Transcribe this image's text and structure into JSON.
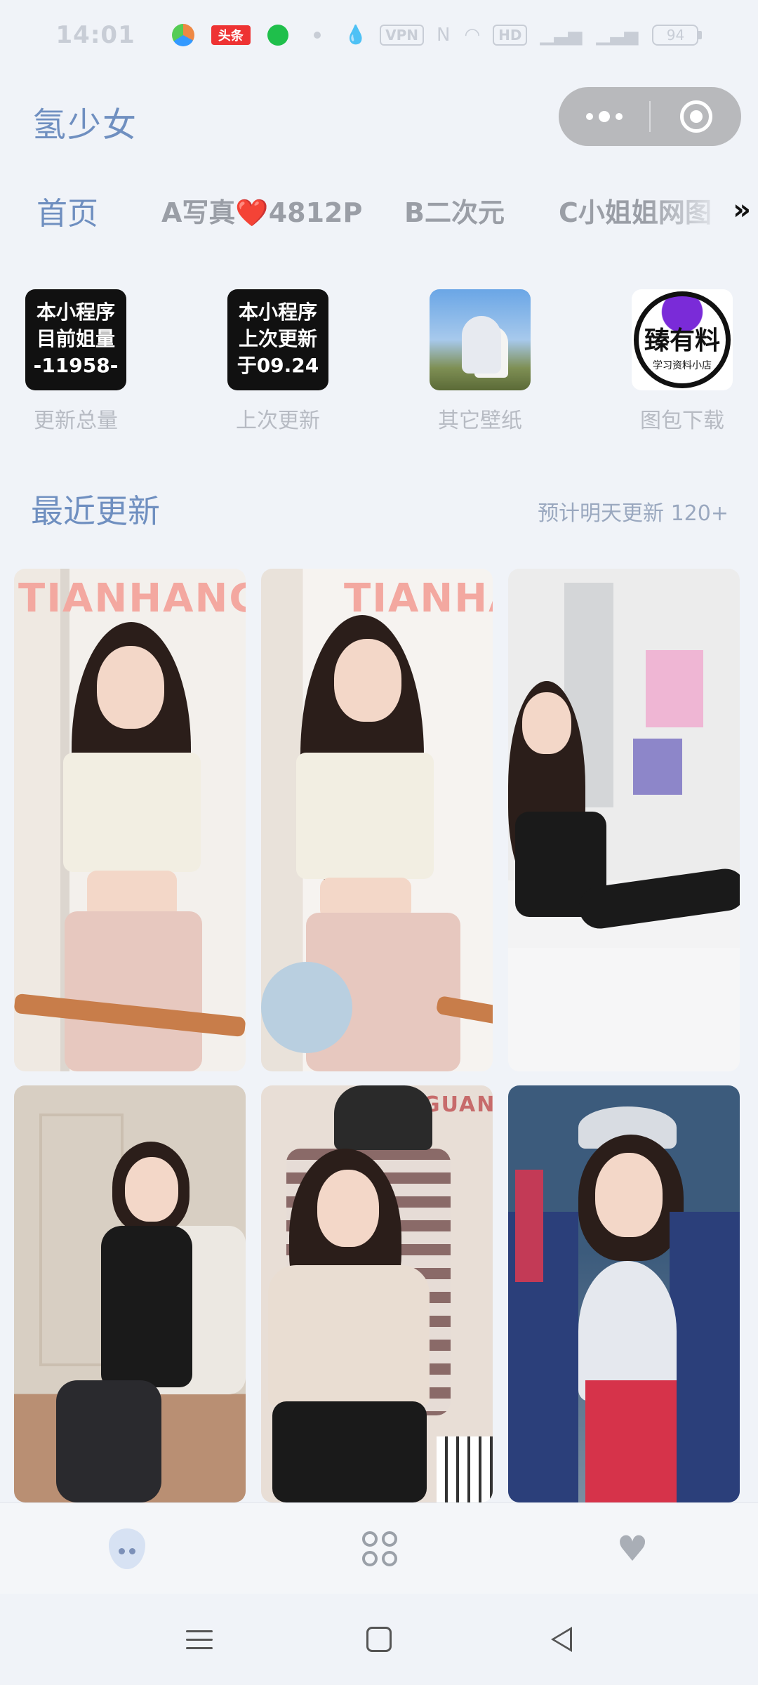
{
  "status_bar": {
    "time": "14:01",
    "icons": [
      "multicolor-app-icon",
      "toutiao-icon",
      "green-app-icon",
      "dot-icon",
      "drop-icon",
      "vpn-icon",
      "nfc-icon",
      "wifi-icon",
      "hd-icon",
      "signal-icon",
      "signal-icon",
      "battery-icon"
    ],
    "toutiao": "头条",
    "vpn": "VPN",
    "hd": "HD",
    "battery": "94"
  },
  "header": {
    "title": "氢少女"
  },
  "tabs": [
    {
      "label": "首页",
      "active": true
    },
    {
      "label": "A写真❤️4812P"
    },
    {
      "label": "B二次元"
    },
    {
      "label": "C小姐姐网图"
    }
  ],
  "tabs_more": "»",
  "categories": [
    {
      "tile_lines": [
        "本小程序",
        "目前姐量",
        "-11958-"
      ],
      "label": "更新总量"
    },
    {
      "tile_lines": [
        "本小程序",
        "上次更新",
        "于09.24"
      ],
      "label": "上次更新"
    },
    {
      "tile_lines": [],
      "label": "其它壁纸"
    },
    {
      "tile_lines": [
        "臻有料",
        "学习资料小店"
      ],
      "label": "图包下载"
    }
  ],
  "section": {
    "title": "最近更新",
    "note": "预计明天更新 120+"
  },
  "photo_watermarks": [
    "TIANHANG",
    "TIANHAI",
    "",
    "",
    "GUANG",
    ""
  ],
  "colors": {
    "accent": "#6f8fc0",
    "background": "#f0f3f8"
  }
}
